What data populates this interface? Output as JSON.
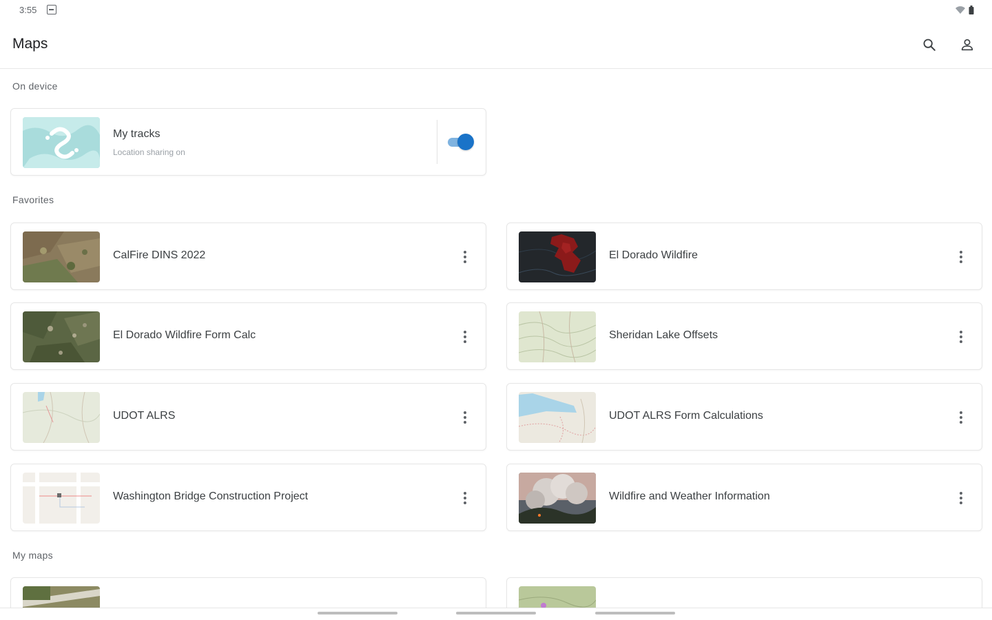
{
  "status_bar": {
    "time": "3:55"
  },
  "app_bar": {
    "title": "Maps"
  },
  "sections": {
    "on_device": "On device",
    "favorites": "Favorites",
    "my_maps": "My maps"
  },
  "my_tracks": {
    "title": "My tracks",
    "subtitle": "Location sharing on",
    "toggle_on": true
  },
  "favorites": [
    {
      "title": "CalFire DINS 2022",
      "thumb": "satellite-brown"
    },
    {
      "title": "El Dorado Wildfire",
      "thumb": "dark-fire"
    },
    {
      "title": "El Dorado Wildfire Form Calc",
      "thumb": "satellite-green"
    },
    {
      "title": "Sheridan Lake Offsets",
      "thumb": "topo-green"
    },
    {
      "title": "UDOT ALRS",
      "thumb": "topo-light"
    },
    {
      "title": "UDOT ALRS Form Calculations",
      "thumb": "topo-lake"
    },
    {
      "title": "Washington Bridge Construction Project",
      "thumb": "street-light"
    },
    {
      "title": "Wildfire and Weather Information",
      "thumb": "smoke-photo"
    }
  ],
  "colors": {
    "accent": "#1a73c8",
    "accent_track": "#7fb3e0",
    "card_border": "#e6e6e6"
  }
}
